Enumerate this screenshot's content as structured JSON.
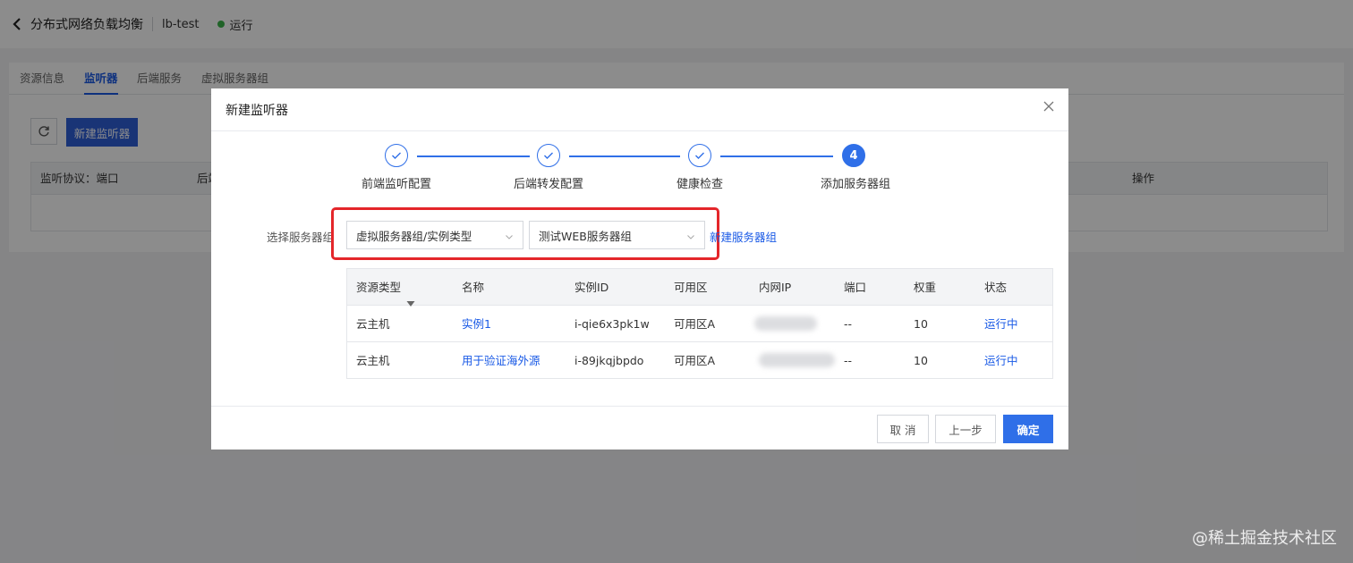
{
  "header": {
    "title": "分布式网络负载均衡",
    "instance": "lb-test",
    "status": "运行",
    "status_color": "#3bb54a"
  },
  "tabs": [
    {
      "label": "资源信息",
      "active": false
    },
    {
      "label": "监听器",
      "active": true
    },
    {
      "label": "后端服务",
      "active": false
    },
    {
      "label": "虚拟服务器组",
      "active": false
    }
  ],
  "toolbar": {
    "new_listener_label": "新建监听器"
  },
  "bg_table": {
    "columns": [
      "监听协议：端口",
      "后端",
      "操作"
    ]
  },
  "modal": {
    "title": "新建监听器",
    "steps": [
      {
        "label": "前端监听配置",
        "state": "done"
      },
      {
        "label": "后端转发配置",
        "state": "done"
      },
      {
        "label": "健康检查",
        "state": "done"
      },
      {
        "label": "添加服务器组",
        "state": "current",
        "number": "4"
      }
    ],
    "field_label": "选择服务器组",
    "select_type": "虚拟服务器组/实例类型",
    "select_group": "测试WEB服务器组",
    "new_group_link": "新建服务器组",
    "table": {
      "columns": [
        "资源类型",
        "名称",
        "实例ID",
        "可用区",
        "内网IP",
        "端口",
        "权重",
        "状态"
      ],
      "rows": [
        {
          "type": "云主机",
          "name": "实例1",
          "id": "i-qie6x3pk1w",
          "zone": "可用区A",
          "port": "--",
          "weight": "10",
          "status": "运行中"
        },
        {
          "type": "云主机",
          "name": "用于验证海外源",
          "id": "i-89jkqjbpdo",
          "zone": "可用区A",
          "port": "--",
          "weight": "10",
          "status": "运行中"
        }
      ]
    },
    "footer": {
      "cancel": "取 消",
      "prev": "上一步",
      "confirm": "确定"
    }
  },
  "watermark": "@稀土掘金技术社区",
  "colors": {
    "accent": "#2f6fe8",
    "highlight_box": "#e4262a"
  }
}
